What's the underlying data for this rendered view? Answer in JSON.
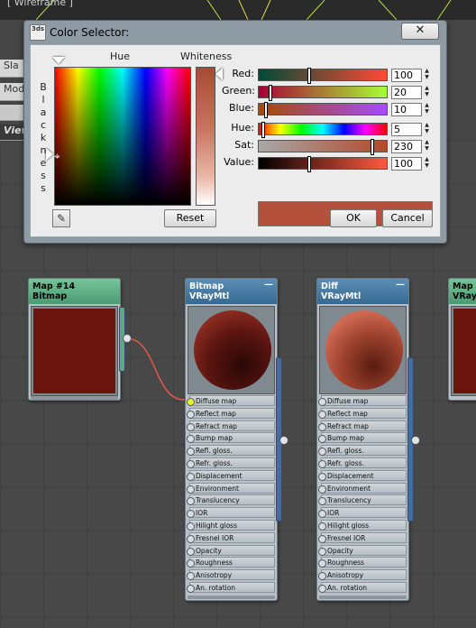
{
  "viewport_label": "[ Wireframe ]",
  "background_panels": {
    "slate_title": "Sla",
    "modes_menu": "Mode",
    "view_label": "View"
  },
  "dialog": {
    "title": "Color Selector:",
    "app_icon": "3ds",
    "close_icon": "close-x-icon",
    "hue_header": "Hue",
    "whiteness_header": "Whiteness",
    "blackness_vertical": [
      "B",
      "l",
      "a",
      "c",
      "k",
      "n",
      "e",
      "s",
      "s"
    ],
    "sliders": [
      {
        "label": "Red:",
        "value": "100",
        "fraction": 0.39,
        "gradient": "linear-gradient(to right,#004a35,#ff4a35)"
      },
      {
        "label": "Green:",
        "value": "20",
        "fraction": 0.08,
        "gradient": "linear-gradient(to right,#a80035,#a8ff35)"
      },
      {
        "label": "Blue:",
        "value": "10",
        "fraction": 0.04,
        "gradient": "linear-gradient(to right,#a84a00,#a84aff)"
      },
      {
        "label": "Hue:",
        "value": "5",
        "fraction": 0.02,
        "gradient": "linear-gradient(to right,#ff0000,#ffff00,#00ff00,#00ffff,#0000ff,#ff00ff,#ff0000)"
      },
      {
        "label": "Sat:",
        "value": "230",
        "fraction": 0.9,
        "gradient": "linear-gradient(to right,#a8a8a8,#b44a2a)"
      },
      {
        "label": "Value:",
        "value": "100",
        "fraction": 0.39,
        "gradient": "linear-gradient(to right,#000000,#ff5a40)"
      }
    ],
    "swatch_color": "#b4503c",
    "reset_label": "Reset",
    "ok_label": "OK",
    "cancel_label": "Cancel",
    "eyedropper_icon": "eyedropper-icon"
  },
  "nodes": [
    {
      "id": "map14",
      "title": "Map #14",
      "subtitle": "Bitmap",
      "color": "green",
      "map_color": "#6b140e"
    },
    {
      "id": "bitmap",
      "title": "Bitmap",
      "subtitle": "VRayMtl",
      "color": "blue",
      "sphere_color": "#7a1f18",
      "slots": [
        "Diffuse map",
        "Reflect map",
        "Refract map",
        "Bump map",
        "Refl. gloss.",
        "Refr. gloss.",
        "Displacement",
        "Environment",
        "Translucency",
        "IOR",
        "Hilight gloss",
        "Fresnel IOR",
        "Opacity",
        "Roughness",
        "Anisotropy",
        "An. rotation"
      ]
    },
    {
      "id": "diff",
      "title": "Diff",
      "subtitle": "VRayMtl",
      "color": "blue",
      "sphere_color": "#c05540",
      "slots": [
        "Diffuse map",
        "Reflect map",
        "Refract map",
        "Bump map",
        "Refl. gloss.",
        "Refr. gloss.",
        "Displacement",
        "Environment",
        "Translucency",
        "IOR",
        "Hilight gloss",
        "Fresnel IOR",
        "Opacity",
        "Roughness",
        "Anisotropy",
        "An. rotation"
      ]
    },
    {
      "id": "map_partial",
      "title": "Map",
      "subtitle": "VRayC",
      "color": "green",
      "map_color": "#6b140e"
    }
  ]
}
